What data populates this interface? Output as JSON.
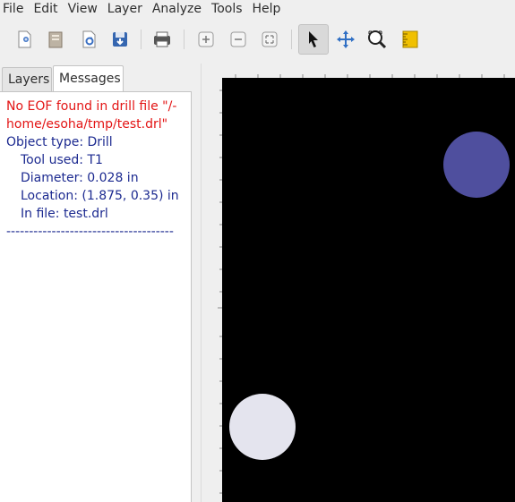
{
  "menu": [
    "File",
    "Edit",
    "View",
    "Layer",
    "Analyze",
    "Tools",
    "Help"
  ],
  "toolbar": {
    "icons": [
      "new-file-icon",
      "open-folder-icon",
      "revert-icon",
      "save-icon",
      "print-icon",
      "zoom-in-icon",
      "zoom-out-icon",
      "zoom-fit-icon",
      "pointer-icon",
      "pan-icon",
      "zoom-tool-icon",
      "measure-icon"
    ],
    "active": "pointer-icon"
  },
  "tabs": {
    "layers": "Layers",
    "messages": "Messages",
    "active": "messages"
  },
  "messages": {
    "error_line1": "No EOF found in drill file \"/-",
    "error_line2": "home/esoha/tmp/test.drl\"",
    "object_type": "Object type: Drill",
    "tool_used": "Tool used: T1",
    "diameter": "Diameter: 0.028 in",
    "location": "Location: (1.875, 0.35) in",
    "in_file": "In file: test.drl",
    "separator": "-------------------------------------"
  },
  "colors": {
    "error": "#e31414",
    "info": "#1c2a90",
    "canvas_bg": "#000000",
    "drill_selected": "#4f4f9e",
    "drill_normal": "#e4e4ee",
    "measure_yellow": "#f0c000"
  }
}
